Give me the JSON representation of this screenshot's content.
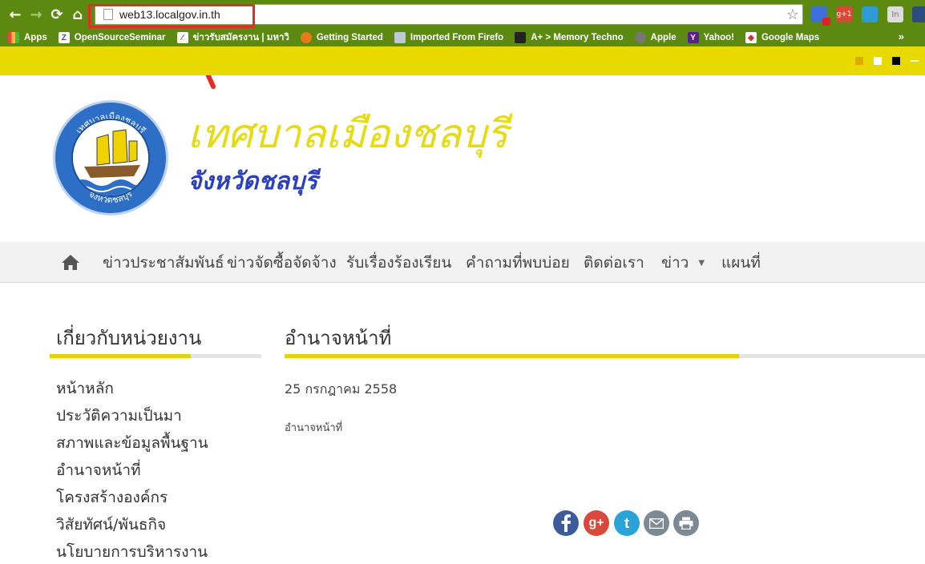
{
  "browser": {
    "url": "web13.localgov.in.th",
    "bookmarks": [
      "Apps",
      "OpenSourceSeminar",
      "ข่าวรับสมัครงาน | มหาวิ",
      "Getting Started",
      "Imported From Firefo",
      "A+ > Memory Techno",
      "Apple",
      "Yahoo!",
      "Google Maps"
    ],
    "bookmarks_overflow": "»",
    "extension_labels": [
      "g+1",
      "In"
    ]
  },
  "site": {
    "title": "เทศบาลเมืองชลบุรี",
    "subtitle": "จังหวัดชลบุรี",
    "logo_text_top": "เทศบาลเมืองชลบุรี",
    "logo_text_bottom": "จังหวัดชลบุรี"
  },
  "menu": {
    "items": [
      "ข่าวประชาสัมพันธ์",
      "ข่าวจัดซื้อจัดจ้าง",
      "รับเรื่องร้องเรียน",
      "คำถามที่พบบ่อย",
      "ติดต่อเรา",
      "ข่าว",
      "แผนที่"
    ]
  },
  "sidebar": {
    "title": "เกี่ยวกับหน่วยงาน",
    "links": [
      "หน้าหลัก",
      "ประวัติความเป็นมา",
      "สภาพและข้อมูลพื้นฐาน",
      "อำนาจหน้าที่",
      "โครงสร้างองค์กร",
      "วิสัยทัศน์/พันธกิจ",
      "นโยบายการบริหารงาน"
    ]
  },
  "main": {
    "title": "อำนาจหน้าที่",
    "date": "25 กรกฎาคม 2558",
    "body": "อำนาจหน้าที่"
  },
  "share": {
    "icons": [
      "facebook-icon",
      "google-plus-icon",
      "twitter-icon",
      "email-icon",
      "print-icon"
    ],
    "gplus_glyph": "g+",
    "twitter_glyph": "t"
  },
  "colors": {
    "chrome_green": "#5c8a10",
    "accent_yellow": "#e8d900",
    "title_yellow": "#e6da10",
    "subtitle_blue": "#2a40c0",
    "highlight_red": "#e52b25"
  }
}
